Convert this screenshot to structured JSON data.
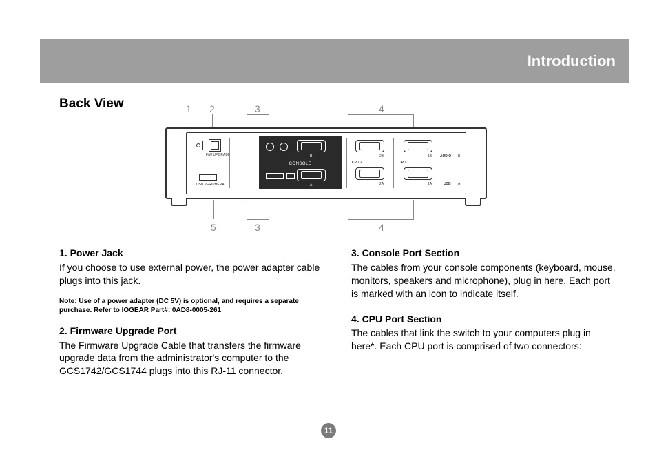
{
  "header": {
    "title": "Introduction"
  },
  "section": {
    "title": "Back View"
  },
  "callouts": {
    "n1": "1",
    "n2": "2",
    "n3t": "3",
    "n4t": "4",
    "n5": "5",
    "n3b": "3",
    "n4b": "4"
  },
  "diagram": {
    "console_label": "CONSOLE",
    "cpu2": "CPU 2",
    "cpu1": "CPU 1",
    "audio": "AUDIO",
    "usb": "USB",
    "usb_periph": "USB PERIPHERAL",
    "fw": "F/W UPGRADE",
    "p2b": "2B",
    "p1b": "1B",
    "p2a": "2A",
    "p1a": "1A",
    "b": "B",
    "a": "A",
    "boxA": "A",
    "boxB": "B"
  },
  "left": {
    "h1": "1. Power Jack",
    "p1": "If you choose to use external power, the power adapter cable plugs into this jack.",
    "note": "Note: Use of a power adapter (DC 5V) is optional, and requires a separate purchase. Refer to IOGEAR Part#: 0AD8-0005-261",
    "h2": "2. Firmware Upgrade Port",
    "p2": "The Firmware Upgrade Cable that transfers the firmware upgrade data from the administrator's computer to the GCS1742/GCS1744 plugs into this RJ-11 connector."
  },
  "right": {
    "h3": "3. Console Port Section",
    "p3": "The cables from your console components (keyboard, mouse, monitors, speakers and microphone), plug in here. Each port is marked with an icon to indicate itself.",
    "h4": "4. CPU Port Section",
    "p4": "The cables that link the switch to your computers plug in here*. Each CPU port is comprised of two connectors:"
  },
  "page": "11"
}
